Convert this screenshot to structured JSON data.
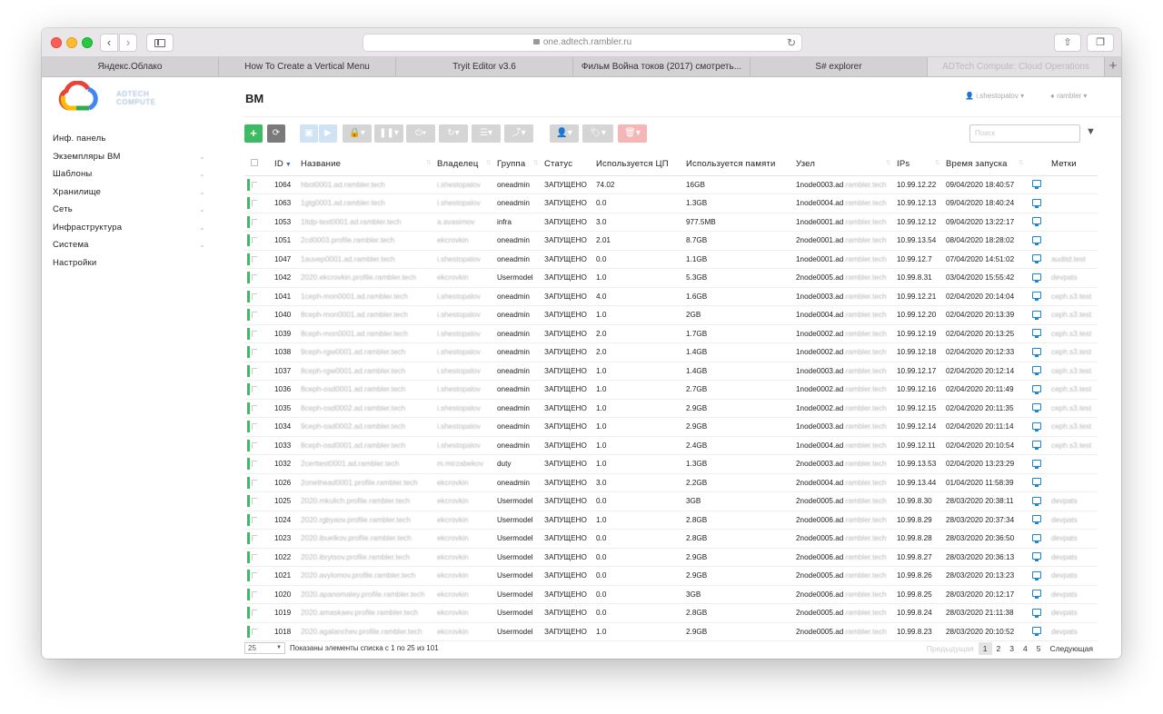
{
  "browser": {
    "url": "one.adtech.rambler.ru",
    "tabs": [
      "Яндекс.Облако",
      "How To Create a Vertical Menu",
      "Tryit Editor v3.6",
      "Фильм Война токов (2017) смотреть...",
      "S# explorer",
      "ADTech Compute: Cloud Operations"
    ]
  },
  "logo": {
    "text_line1": "ADTECH",
    "text_line2": "COMPUTE"
  },
  "sidebar": {
    "items": [
      {
        "label": "Инф. панель",
        "chevron": false
      },
      {
        "label": "Экземпляры ВМ",
        "chevron": true
      },
      {
        "label": "Шаблоны",
        "chevron": true
      },
      {
        "label": "Хранилище",
        "chevron": true
      },
      {
        "label": "Сеть",
        "chevron": true
      },
      {
        "label": "Инфраструктура",
        "chevron": true
      },
      {
        "label": "Система",
        "chevron": true
      },
      {
        "label": "Настройки",
        "chevron": false
      }
    ]
  },
  "header": {
    "title": "ВМ",
    "user": "i.shestopalov",
    "zone": "rambler"
  },
  "toolbar": {
    "create": "+",
    "refresh": "⟳",
    "search_placeholder": "Поиск",
    "filter_icon": "▼"
  },
  "table": {
    "columns": [
      "ID",
      "Название",
      "Владелец",
      "Группа",
      "Статус",
      "Используется ЦП",
      "Используется памяти",
      "Узел",
      "IPs",
      "Время запуска",
      "",
      "Метки"
    ],
    "rows": [
      {
        "id": "1064",
        "name": "hbot0001.ad.rambler.tech",
        "owner": "i.shestopalov",
        "group": "oneadmin",
        "status": "ЗАПУЩЕНО",
        "cpu": "74.02",
        "mem": "16GB",
        "node": "1node0003.ad",
        "node_suffix": ".rambler.tech",
        "ip": "10.99.12.22",
        "time": "09/04/2020 18:40:57",
        "label": ""
      },
      {
        "id": "1063",
        "name": "1gtg0001.ad.rambler.tech",
        "owner": "i.shestopalov",
        "group": "oneadmin",
        "status": "ЗАПУЩЕНО",
        "cpu": "0.0",
        "mem": "1.3GB",
        "node": "1node0004.ad",
        "node_suffix": ".rambler.tech",
        "ip": "10.99.12.13",
        "time": "09/04/2020 18:40:24",
        "label": ""
      },
      {
        "id": "1053",
        "name": "1ltdp-test0001.ad.rambler.tech",
        "owner": "a.avasimov",
        "group": "infra",
        "status": "ЗАПУЩЕНО",
        "cpu": "3.0",
        "mem": "977.5MB",
        "node": "1node0001.ad",
        "node_suffix": ".rambler.tech",
        "ip": "10.99.12.12",
        "time": "09/04/2020 13:22:17",
        "label": ""
      },
      {
        "id": "1051",
        "name": "2cd0003.profile.rambler.tech",
        "owner": "ekcrovkin",
        "group": "oneadmin",
        "status": "ЗАПУЩЕНО",
        "cpu": "2.01",
        "mem": "8.7GB",
        "node": "2node0001.ad",
        "node_suffix": ".rambler.tech",
        "ip": "10.99.13.54",
        "time": "08/04/2020 18:28:02",
        "label": ""
      },
      {
        "id": "1047",
        "name": "1auvep0001.ad.rambler.tech",
        "owner": "i.shestopalov",
        "group": "oneadmin",
        "status": "ЗАПУЩЕНО",
        "cpu": "0.0",
        "mem": "1.1GB",
        "node": "1node0001.ad",
        "node_suffix": ".rambler.tech",
        "ip": "10.99.12.7",
        "time": "07/04/2020 14:51:02",
        "label": "auditd.test"
      },
      {
        "id": "1042",
        "name": "2020.ekcrovkin.profile.rambler.tech",
        "owner": "ekcrovkin",
        "group": "Usermodel",
        "status": "ЗАПУЩЕНО",
        "cpu": "1.0",
        "mem": "5.3GB",
        "node": "2node0005.ad",
        "node_suffix": ".rambler.tech",
        "ip": "10.99.8.31",
        "time": "03/04/2020 15:55:42",
        "label": "devpats"
      },
      {
        "id": "1041",
        "name": "1ceph-mon0001.ad.rambler.tech",
        "owner": "i.shestopalov",
        "group": "oneadmin",
        "status": "ЗАПУЩЕНО",
        "cpu": "4.0",
        "mem": "1.6GB",
        "node": "1node0003.ad",
        "node_suffix": ".rambler.tech",
        "ip": "10.99.12.21",
        "time": "02/04/2020 20:14:04",
        "label": "ceph.s3.test"
      },
      {
        "id": "1040",
        "name": "8ceph-mon0001.ad.rambler.tech",
        "owner": "i.shestopalov",
        "group": "oneadmin",
        "status": "ЗАПУЩЕНО",
        "cpu": "1.0",
        "mem": "2GB",
        "node": "1node0004.ad",
        "node_suffix": ".rambler.tech",
        "ip": "10.99.12.20",
        "time": "02/04/2020 20:13:39",
        "label": "ceph.s3.test"
      },
      {
        "id": "1039",
        "name": "8ceph-mon0001.ad.rambler.tech",
        "owner": "i.shestopalov",
        "group": "oneadmin",
        "status": "ЗАПУЩЕНО",
        "cpu": "2.0",
        "mem": "1.7GB",
        "node": "1node0002.ad",
        "node_suffix": ".rambler.tech",
        "ip": "10.99.12.19",
        "time": "02/04/2020 20:13:25",
        "label": "ceph.s3.test"
      },
      {
        "id": "1038",
        "name": "9ceph-rgw0001.ad.rambler.tech",
        "owner": "i.shestopalov",
        "group": "oneadmin",
        "status": "ЗАПУЩЕНО",
        "cpu": "2.0",
        "mem": "1.4GB",
        "node": "1node0002.ad",
        "node_suffix": ".rambler.tech",
        "ip": "10.99.12.18",
        "time": "02/04/2020 20:12:33",
        "label": "ceph.s3.test"
      },
      {
        "id": "1037",
        "name": "8ceph-rgw0001.ad.rambler.tech",
        "owner": "i.shestopalov",
        "group": "oneadmin",
        "status": "ЗАПУЩЕНО",
        "cpu": "1.0",
        "mem": "1.4GB",
        "node": "1node0003.ad",
        "node_suffix": ".rambler.tech",
        "ip": "10.99.12.17",
        "time": "02/04/2020 20:12:14",
        "label": "ceph.s3.test"
      },
      {
        "id": "1036",
        "name": "8ceph-osd0001.ad.rambler.tech",
        "owner": "i.shestopalov",
        "group": "oneadmin",
        "status": "ЗАПУЩЕНО",
        "cpu": "1.0",
        "mem": "2.7GB",
        "node": "1node0002.ad",
        "node_suffix": ".rambler.tech",
        "ip": "10.99.12.16",
        "time": "02/04/2020 20:11:49",
        "label": "ceph.s3.test"
      },
      {
        "id": "1035",
        "name": "8ceph-osd0002.ad.rambler.tech",
        "owner": "i.shestopalov",
        "group": "oneadmin",
        "status": "ЗАПУЩЕНО",
        "cpu": "1.0",
        "mem": "2.9GB",
        "node": "1node0002.ad",
        "node_suffix": ".rambler.tech",
        "ip": "10.99.12.15",
        "time": "02/04/2020 20:11:35",
        "label": "ceph.s3.test"
      },
      {
        "id": "1034",
        "name": "9ceph-osd0002.ad.rambler.tech",
        "owner": "i.shestopalov",
        "group": "oneadmin",
        "status": "ЗАПУЩЕНО",
        "cpu": "1.0",
        "mem": "2.9GB",
        "node": "1node0003.ad",
        "node_suffix": ".rambler.tech",
        "ip": "10.99.12.14",
        "time": "02/04/2020 20:11:14",
        "label": "ceph.s3.test"
      },
      {
        "id": "1033",
        "name": "8ceph-osd0001.ad.rambler.tech",
        "owner": "i.shestopalov",
        "group": "oneadmin",
        "status": "ЗАПУЩЕНО",
        "cpu": "1.0",
        "mem": "2.4GB",
        "node": "1node0004.ad",
        "node_suffix": ".rambler.tech",
        "ip": "10.99.12.11",
        "time": "02/04/2020 20:10:54",
        "label": "ceph.s3.test"
      },
      {
        "id": "1032",
        "name": "2certtest0001.ad.rambler.tech",
        "owner": "m.mirzabekov",
        "group": "duty",
        "status": "ЗАПУЩЕНО",
        "cpu": "1.0",
        "mem": "1.3GB",
        "node": "2node0003.ad",
        "node_suffix": ".rambler.tech",
        "ip": "10.99.13.53",
        "time": "02/04/2020 13:23:29",
        "label": ""
      },
      {
        "id": "1026",
        "name": "2onethead0001.profile.rambler.tech",
        "owner": "ekcrovkin",
        "group": "oneadmin",
        "status": "ЗАПУЩЕНО",
        "cpu": "3.0",
        "mem": "2.2GB",
        "node": "2node0004.ad",
        "node_suffix": ".rambler.tech",
        "ip": "10.99.13.44",
        "time": "01/04/2020 11:58:39",
        "label": ""
      },
      {
        "id": "1025",
        "name": "2020.mkulich.profile.rambler.tech",
        "owner": "ekcrovkin",
        "group": "Usermodel",
        "status": "ЗАПУЩЕНО",
        "cpu": "0.0",
        "mem": "3GB",
        "node": "2node0005.ad",
        "node_suffix": ".rambler.tech",
        "ip": "10.99.8.30",
        "time": "28/03/2020 20:38:11",
        "label": "devpats"
      },
      {
        "id": "1024",
        "name": "2020.rgbyaov.profile.rambler.tech",
        "owner": "ekcrovkin",
        "group": "Usermodel",
        "status": "ЗАПУЩЕНО",
        "cpu": "1.0",
        "mem": "2.8GB",
        "node": "2node0006.ad",
        "node_suffix": ".rambler.tech",
        "ip": "10.99.8.29",
        "time": "28/03/2020 20:37:34",
        "label": "devpats"
      },
      {
        "id": "1023",
        "name": "2020.ibuelkov.profile.rambler.tech",
        "owner": "ekcrovkin",
        "group": "Usermodel",
        "status": "ЗАПУЩЕНО",
        "cpu": "0.0",
        "mem": "2.8GB",
        "node": "2node0005.ad",
        "node_suffix": ".rambler.tech",
        "ip": "10.99.8.28",
        "time": "28/03/2020 20:36:50",
        "label": "devpats"
      },
      {
        "id": "1022",
        "name": "2020.ibrytsov.profile.rambler.tech",
        "owner": "ekcrovkin",
        "group": "Usermodel",
        "status": "ЗАПУЩЕНО",
        "cpu": "0.0",
        "mem": "2.9GB",
        "node": "2node0006.ad",
        "node_suffix": ".rambler.tech",
        "ip": "10.99.8.27",
        "time": "28/03/2020 20:36:13",
        "label": "devpats"
      },
      {
        "id": "1021",
        "name": "2020.avylomov.profile.rambler.tech",
        "owner": "ekcrovkin",
        "group": "Usermodel",
        "status": "ЗАПУЩЕНО",
        "cpu": "0.0",
        "mem": "2.9GB",
        "node": "2node0005.ad",
        "node_suffix": ".rambler.tech",
        "ip": "10.99.8.26",
        "time": "28/03/2020 20:13:23",
        "label": "devpats"
      },
      {
        "id": "1020",
        "name": "2020.apanomaley.profile.rambler.tech",
        "owner": "ekcrovkin",
        "group": "Usermodel",
        "status": "ЗАПУЩЕНО",
        "cpu": "0.0",
        "mem": "3GB",
        "node": "2node0006.ad",
        "node_suffix": ".rambler.tech",
        "ip": "10.99.8.25",
        "time": "28/03/2020 20:12:17",
        "label": "devpats"
      },
      {
        "id": "1019",
        "name": "2020.amaskaev.profile.rambler.tech",
        "owner": "ekcrovkin",
        "group": "Usermodel",
        "status": "ЗАПУЩЕНО",
        "cpu": "0.0",
        "mem": "2.8GB",
        "node": "2node0005.ad",
        "node_suffix": ".rambler.tech",
        "ip": "10.99.8.24",
        "time": "28/03/2020 21:11:38",
        "label": "devpats"
      },
      {
        "id": "1018",
        "name": "2020.agalanchev.profile.rambler.tech",
        "owner": "ekcrovkin",
        "group": "Usermodel",
        "status": "ЗАПУЩЕНО",
        "cpu": "1.0",
        "mem": "2.9GB",
        "node": "2node0005.ad",
        "node_suffix": ".rambler.tech",
        "ip": "10.99.8.23",
        "time": "28/03/2020 20:10:52",
        "label": "devpats"
      }
    ]
  },
  "footer": {
    "page_size": "25",
    "info": "Показаны элементы списка с 1 по 25 из 101",
    "prev": "Предыдущая",
    "pages": [
      "1",
      "2",
      "3",
      "4",
      "5"
    ],
    "next": "Следующая"
  },
  "colors": {
    "create_green": "#3dbb62",
    "running_green": "#3dbb62",
    "vnc_blue": "#1d86d3"
  }
}
